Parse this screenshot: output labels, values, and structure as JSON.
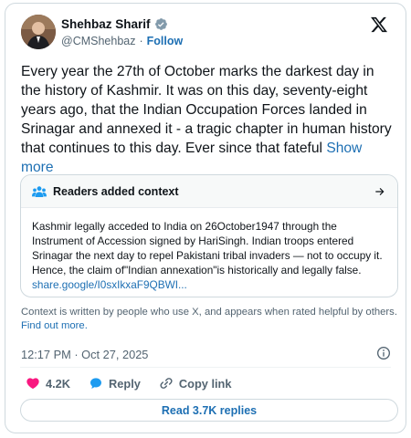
{
  "author": {
    "name": "Shehbaz Sharif",
    "handle": "@CMShehbaz",
    "separator": "·",
    "follow_label": "Follow"
  },
  "tweet": {
    "text": "Every year the 27th of October marks the darkest day in the history of Kashmir. It was on this day, seventy-eight years ago, that the Indian Occupation Forces landed in Srinagar and annexed it - a tragic chapter in human history that continues to this day. Ever since that fateful ",
    "show_more_label": "Show more"
  },
  "context": {
    "title": "Readers added context",
    "body": "Kashmir legally acceded to India on 26October1947 through the Instrument of Accession signed by HariSingh. Indian troops entered Srinagar the next day to repel Pakistani tribal invaders — not to occupy it. Hence, the claim of\"Indian annexation\"is historically and legally false.",
    "link": "share.google/I0sxIkxaF9QBWI..."
  },
  "disclaimer": {
    "text": "Context is written by people who use X, and appears when rated helpful by others. ",
    "link_label": "Find out more."
  },
  "meta": {
    "timestamp": "12:17 PM · Oct 27, 2025"
  },
  "actions": {
    "like_count": "4.2K",
    "reply_label": "Reply",
    "copy_link_label": "Copy link"
  },
  "read_replies_label": "Read 3.7K replies",
  "colors": {
    "accent": "#1d9bf0",
    "link": "#1d6fb3",
    "like": "#f91880",
    "text": "#0f1419",
    "muted": "#536471"
  }
}
